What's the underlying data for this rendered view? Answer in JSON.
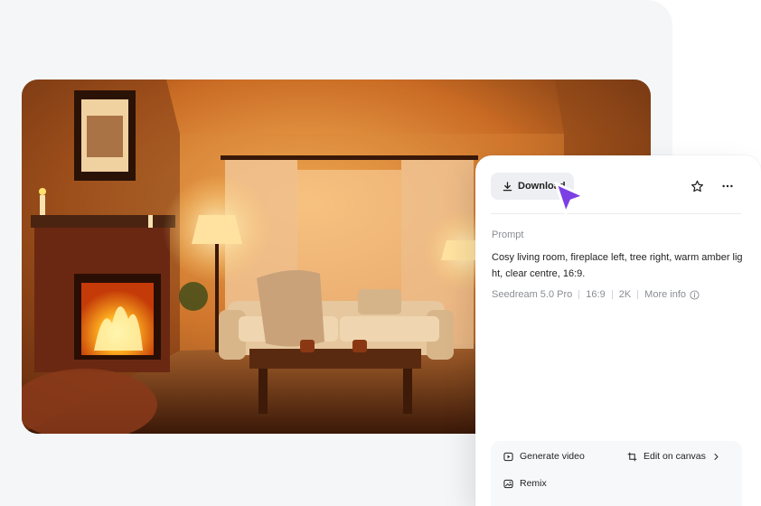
{
  "panel": {
    "download_label": "Download",
    "prompt_label": "Prompt",
    "prompt_text": "Cosy living room, fireplace left, tree right, warm amber light, clear centre, 16:9.",
    "meta": {
      "model": "Seedream 5.0 Pro",
      "ratio": "16:9",
      "resolution": "2K",
      "more_info": "More info"
    },
    "actions": {
      "generate_video": "Generate video",
      "edit_on_canvas": "Edit on canvas",
      "remix": "Remix"
    }
  },
  "icons": {
    "download": "download-icon",
    "star": "star-icon",
    "more": "more-dots-icon",
    "info": "info-icon",
    "play": "play-icon",
    "crop": "crop-icon",
    "chevron": "chevron-right-icon",
    "remix": "image-remix-icon",
    "cursor": "pointer-cursor-icon"
  },
  "colors": {
    "cursor": "#7b3fe4",
    "accent_warm": "#f0a030"
  }
}
